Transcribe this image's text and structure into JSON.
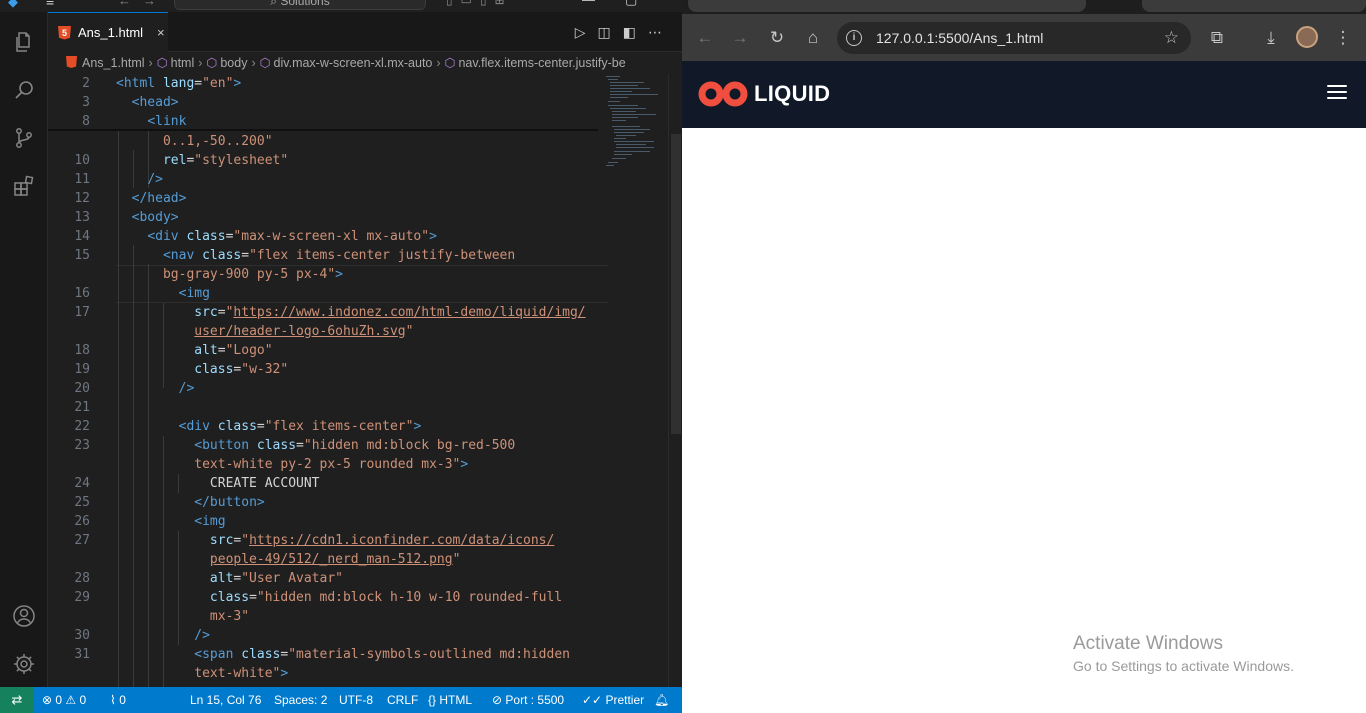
{
  "vscode": {
    "command_center": "Solutions",
    "tab": {
      "label": "Ans_1.html",
      "close": "×"
    },
    "breadcrumbs": [
      "Ans_1.html",
      "html",
      "body",
      "div.max-w-screen-xl.mx-auto",
      "nav.flex.items-center.justify-be"
    ],
    "code_lines": [
      {
        "n": "2"
      },
      {
        "n": "3"
      },
      {
        "n": "8"
      },
      {
        "n": ""
      },
      {
        "n": "10"
      },
      {
        "n": "11"
      },
      {
        "n": "12"
      },
      {
        "n": "13"
      },
      {
        "n": "14"
      },
      {
        "n": "15"
      },
      {
        "n": ""
      },
      {
        "n": "16"
      },
      {
        "n": "17"
      },
      {
        "n": ""
      },
      {
        "n": "18"
      },
      {
        "n": "19"
      },
      {
        "n": "20"
      },
      {
        "n": "21"
      },
      {
        "n": "22"
      },
      {
        "n": "23"
      },
      {
        "n": ""
      },
      {
        "n": "24"
      },
      {
        "n": "25"
      },
      {
        "n": "26"
      },
      {
        "n": "27"
      },
      {
        "n": ""
      },
      {
        "n": "28"
      },
      {
        "n": "29"
      },
      {
        "n": ""
      },
      {
        "n": "30"
      },
      {
        "n": "31"
      },
      {
        "n": ""
      }
    ],
    "code": {
      "l2": [
        "<html",
        " lang",
        "=",
        "\"en\"",
        ">"
      ],
      "l3": "<head>",
      "l8": "<link",
      "l9": "0..1,-50..200\"",
      "l10": [
        "rel",
        "=",
        "\"stylesheet\""
      ],
      "l11": "/>",
      "l12": "</head>",
      "l13": "<body>",
      "l14": [
        "<div",
        " class",
        "=",
        "\"max-w-screen-xl mx-auto\"",
        ">"
      ],
      "l15a": [
        "<nav",
        " class",
        "=",
        "\"flex items-center justify-between"
      ],
      "l15b": [
        "bg-gray-900 py-5 px-4\"",
        ">"
      ],
      "l16": "<img",
      "l17a": [
        "src",
        "=",
        "\"",
        "https://www.indonez.com/html-demo/liquid/img/"
      ],
      "l17b": [
        "user/header-logo-6ohuZh.svg",
        "\""
      ],
      "l18": [
        "alt",
        "=",
        "\"Logo\""
      ],
      "l19": [
        "class",
        "=",
        "\"w-32\""
      ],
      "l20": "/>",
      "l22": [
        "<div",
        " class",
        "=",
        "\"flex items-center\"",
        ">"
      ],
      "l23a": [
        "<button",
        " class",
        "=",
        "\"hidden md:block bg-red-500"
      ],
      "l23b": [
        "text-white py-2 px-5 rounded mx-3\"",
        ">"
      ],
      "l24": "CREATE ACCOUNT",
      "l25": "</button>",
      "l26": "<img",
      "l27a": [
        "src",
        "=",
        "\"",
        "https://cdn1.iconfinder.com/data/icons/"
      ],
      "l27b": [
        "people-49/512/_nerd_man-512.png",
        "\""
      ],
      "l28": [
        "alt",
        "=",
        "\"User Avatar\""
      ],
      "l29a": [
        "class",
        "=",
        "\"hidden md:block h-10 w-10 rounded-full"
      ],
      "l29b": "mx-3\"",
      "l30": "/>",
      "l31a": [
        "<span",
        " class",
        "=",
        "\"material-symbols-outlined md:hidden"
      ],
      "l31b": [
        "text-white\"",
        ">"
      ]
    },
    "status": {
      "errors": "0",
      "warnings": "0",
      "ports": "0",
      "position": "Ln 15, Col 76",
      "spaces": "Spaces: 2",
      "encoding": "UTF-8",
      "eol": "CRLF",
      "language": "HTML",
      "port": "Port : 5500",
      "prettier": "Prettier"
    }
  },
  "browser": {
    "url": "127.0.0.1:5500/Ans_1.html",
    "site": {
      "logo_text": "LIQUID",
      "nav_bg": "#111827",
      "logo_color": "#f04e3e"
    },
    "watermark": {
      "line1": "Activate Windows",
      "line2": "Go to Settings to activate Windows."
    }
  },
  "icons": [
    "explorer-icon",
    "search-icon",
    "source-control-icon",
    "extensions-icon",
    "account-icon",
    "settings-gear-icon",
    "run-icon",
    "split-editor-icon",
    "more-icon",
    "back-arrow-icon",
    "forward-arrow-icon",
    "reload-icon",
    "home-icon",
    "site-info-icon",
    "bookmark-star-icon",
    "extensions-puzzle-icon",
    "download-icon",
    "profile-avatar-icon",
    "kebab-menu-icon",
    "hamburger-menu-icon"
  ]
}
